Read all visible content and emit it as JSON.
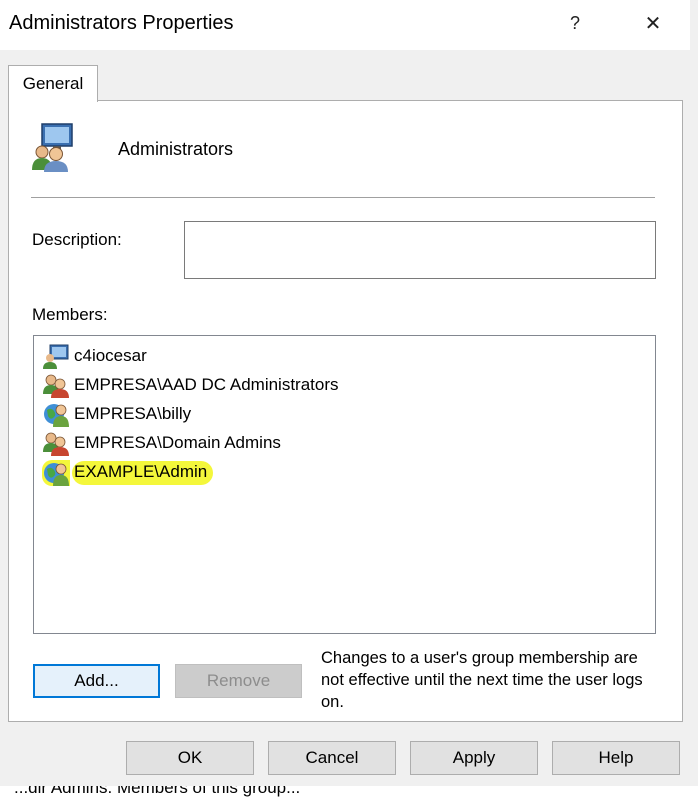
{
  "window": {
    "title": "Administrators Properties",
    "help_label": "?",
    "close_label": "✕"
  },
  "tabs": [
    {
      "label": "General",
      "selected": true
    }
  ],
  "group": {
    "name": "Administrators",
    "icon": "user-group-icon"
  },
  "description": {
    "label": "Description:",
    "value": ""
  },
  "members": {
    "label": "Members:",
    "items": [
      {
        "name": "c4iocesar",
        "icon": "computer-user-icon",
        "highlighted": false
      },
      {
        "name": "EMPRESA\\AAD DC Administrators",
        "icon": "group-icon",
        "highlighted": false
      },
      {
        "name": "EMPRESA\\billy",
        "icon": "domain-user-icon",
        "highlighted": false
      },
      {
        "name": "EMPRESA\\Domain Admins",
        "icon": "group-icon",
        "highlighted": false
      },
      {
        "name": "EXAMPLE\\Admin",
        "icon": "domain-user-icon",
        "highlighted": true
      }
    ],
    "highlight_color": "#f4f73b"
  },
  "buttons": {
    "add": "Add...",
    "remove": "Remove",
    "ok": "OK",
    "cancel": "Cancel",
    "apply": "Apply",
    "help": "Help"
  },
  "note": "Changes to a user's group membership are not effective until the next time the user logs on.",
  "background_text": "...dir Admins. Members of this group..."
}
